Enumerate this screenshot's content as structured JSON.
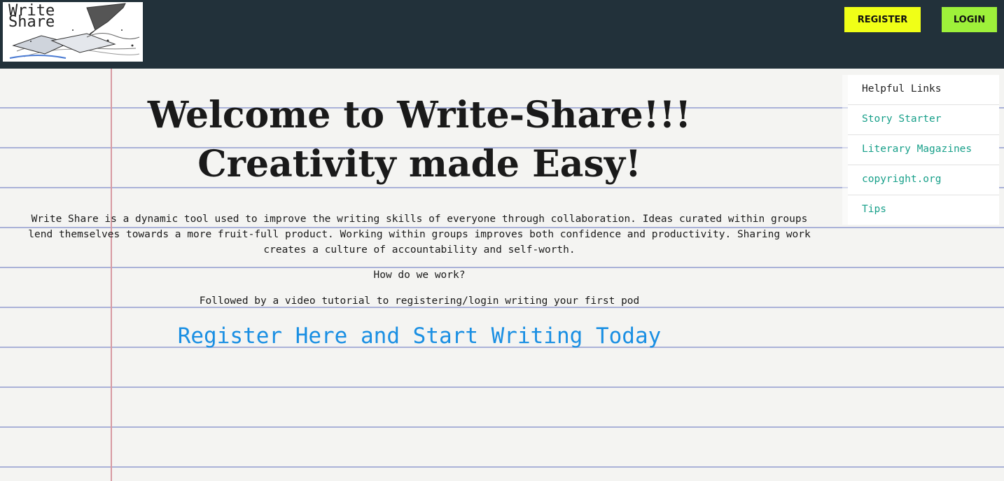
{
  "header": {
    "logo_line1": "Write",
    "logo_line2": "Share",
    "register_label": "REGISTER",
    "login_label": "LOGIN"
  },
  "main": {
    "title_line1": "Welcome to Write-Share!!!",
    "title_line2": "Creativity made Easy!",
    "intro": "Write Share is a dynamic tool used to improve the writing skills of everyone through collaboration. Ideas curated within groups lend themselves towards a more fruit-full product. Working within groups improves both confidence and productivity. Sharing work creates a culture of accountability and self-worth.",
    "how_text": "How do we work?",
    "follow_text": "Followed by a video tutorial to registering/login writing your first pod",
    "cta_label": "Register Here and Start Writing Today"
  },
  "sidebar": {
    "header": "Helpful Links",
    "links": [
      {
        "label": "Story Starter"
      },
      {
        "label": "Literary Magazines"
      },
      {
        "label": "copyright.org"
      },
      {
        "label": "Tips"
      }
    ]
  },
  "colors": {
    "navbar": "#22313a",
    "register_button": "#f0ff17",
    "login_button": "#9ef13a",
    "cta_link": "#1a8fe3",
    "sidebar_link": "#18a08a"
  }
}
